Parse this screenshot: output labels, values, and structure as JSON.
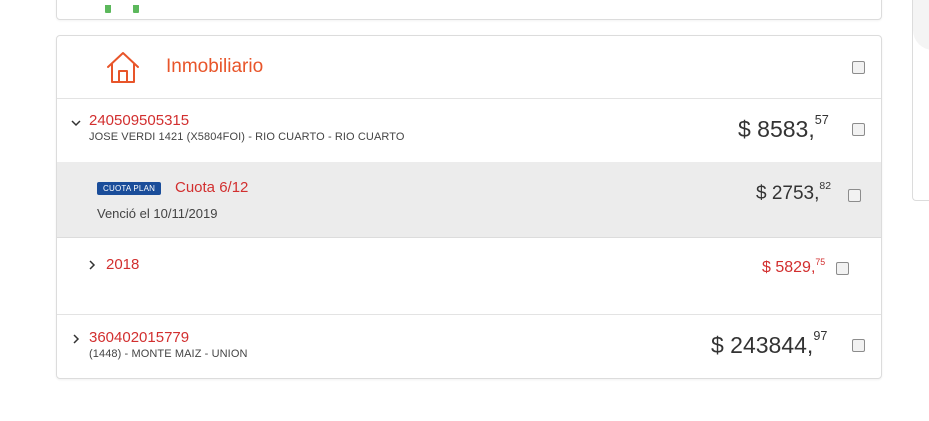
{
  "section": {
    "title": "Inmobiliario",
    "icon": "house-icon",
    "accent": "#e8552a"
  },
  "accounts": [
    {
      "id": "240509505315",
      "address": "JOSE VERDI 1421 (X5804FOI) - RIO CUARTO - RIO CUARTO",
      "amount_int": "$ 8583,",
      "amount_dec": "57",
      "expanded": true
    },
    {
      "id": "360402015779",
      "address": "(1448) - MONTE MAIZ - UNION",
      "amount_int": "$ 243844,",
      "amount_dec": "97",
      "expanded": false
    }
  ],
  "cuota": {
    "badge": "CUOTA PLAN",
    "label": "Cuota 6/12",
    "due_text": "Venció el 10/11/2019",
    "amount_int": "$ 2753,",
    "amount_dec": "82"
  },
  "year_group": {
    "year": "2018",
    "amount_int": "$ 5829,",
    "amount_dec": "75"
  },
  "colors": {
    "red": "#d22f2f",
    "badge_blue": "#1a4d9a",
    "highlight_row": "#ececec"
  }
}
